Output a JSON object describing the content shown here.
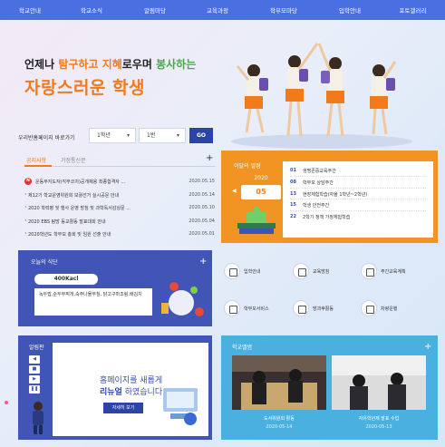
{
  "nav": [
    "학교안내",
    "학교소식",
    "알림마당",
    "교육과정",
    "학부모마당",
    "입학안내",
    "포토갤러리"
  ],
  "hero": {
    "line1_a": "언제나 ",
    "line1_b": "탐구하고",
    "line1_c": " ",
    "line1_d": "지혜",
    "line1_e": "로우며 ",
    "line1_f": "봉사하는",
    "line2": "자랑스러운 학생"
  },
  "quick_select": {
    "label": "우리반홈페이지 바로가기",
    "grade": "1학년",
    "class": "1반",
    "go": "GO"
  },
  "notice": {
    "tab_active": "공지사항",
    "tab_inactive": "가정통신문",
    "new_badge": "N",
    "rows": [
      {
        "title": "운동부지도자(각부코치)공개채용 최종합격자 ...",
        "date": "2020.05.15"
      },
      {
        "title": "제12기 학교운영위원회 보궐선거 실시공문 안내",
        "date": "2020.05.14"
      },
      {
        "title": "2020 학력평 및 행사 운영 방침 및 과학독서감상문 ...",
        "date": "2020.05.10"
      },
      {
        "title": "2020 EBS 탐방 등교활동 발표대회 안내",
        "date": "2020.05.04"
      },
      {
        "title": "2020학년도 학부모 총회 및 임원 선출 안내",
        "date": "2020.05.01"
      }
    ]
  },
  "schedule": {
    "title": "이달의 일정",
    "year": "2020",
    "month": "05",
    "prev": "◀",
    "next": "▶",
    "rows": [
      {
        "d": "01",
        "t": "생명존중교육주간"
      },
      {
        "d": "08",
        "t": "학부모 상담주간"
      },
      {
        "d": "13",
        "t": "현장체험학습(자율 1학년~2학년)"
      },
      {
        "d": "15",
        "t": "학생 안전주간"
      },
      {
        "d": "22",
        "t": "2학기 정책 가정체험학습"
      }
    ]
  },
  "menu": {
    "title": "오늘의 식단",
    "kcal": "400Kacl",
    "text": "녹두밥,순두부찌개,숙주나물무침, 닭고구마조림,배김치"
  },
  "quick_links": [
    "입학안내",
    "교육방침",
    "주간교육계획",
    "학부모서비스",
    "방과후활동",
    "차량운행"
  ],
  "popup": {
    "title": "알림판",
    "line1": "홈페이지를 새롭게",
    "line2_a": "리뉴얼",
    "line2_b": " 하였습니다.",
    "btn": "자세히 보기",
    "ctrl": [
      "◀",
      "■",
      "▶",
      "❚❚"
    ]
  },
  "album": {
    "title": "학교앨범",
    "items": [
      {
        "caption": "도서위원회 활동",
        "date": "2020-05-14"
      },
      {
        "caption": "자유학년제 발표 수업",
        "date": "2020-05-13"
      }
    ]
  },
  "plus": "+"
}
